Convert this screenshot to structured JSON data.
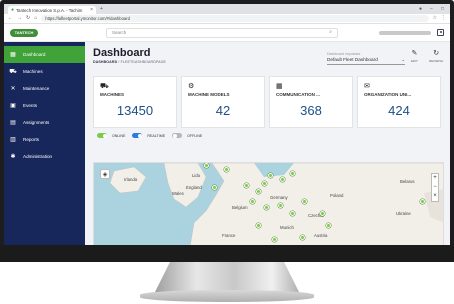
{
  "browser": {
    "tab_title": "Tantech Innovation S.p.A. - Tachim",
    "url": "https://lafleetportal.ymonitor.com/#/dashboard"
  },
  "header": {
    "logo_text": "TANTECH",
    "search_placeholder": "Search"
  },
  "sidebar": {
    "items": [
      {
        "label": "Dashboard",
        "icon": "grid-icon",
        "active": true
      },
      {
        "label": "Machines",
        "icon": "truck-icon",
        "active": false
      },
      {
        "label": "Maintenance",
        "icon": "wrench-icon",
        "active": false
      },
      {
        "label": "Events",
        "icon": "calendar-icon",
        "active": false
      },
      {
        "label": "Assignments",
        "icon": "assignment-icon",
        "active": false
      },
      {
        "label": "Reports",
        "icon": "chart-icon",
        "active": false
      },
      {
        "label": "Administration",
        "icon": "gear-icon",
        "active": false
      }
    ]
  },
  "page": {
    "title": "Dashboard",
    "breadcrumb_root": "DASHBOARD",
    "breadcrumb_tail": "/ FLEETDASHBOARDPAGE",
    "dashboard_label": "Dashboard impostata",
    "dashboard_value": "Default Fleet Dashboard",
    "edit_label": "EDIT",
    "refresh_label": "REFRESH"
  },
  "cards": [
    {
      "title": "MACHINES",
      "value": "13450",
      "icon": "truck-icon"
    },
    {
      "title": "MACHINE MODELS",
      "value": "42",
      "icon": "machine-models-icon"
    },
    {
      "title": "COMMUNICATION ...",
      "value": "368",
      "icon": "device-icon"
    },
    {
      "title": "ORGANIZATION UNI...",
      "value": "424",
      "icon": "organization-icon"
    }
  ],
  "legend": {
    "online": "ONLINE",
    "realtime": "REALTIME",
    "offline": "OFFLINE"
  },
  "map": {
    "places": [
      "Irlanda",
      "Lido",
      "Wales",
      "England",
      "Belgium",
      "Germany",
      "Czechia",
      "Poland",
      "Belarus",
      "France",
      "Austria",
      "Ukraine",
      "Munich"
    ]
  },
  "colors": {
    "sidebar": "#17265b",
    "active": "#3fa33a",
    "online": "#7ec84a",
    "realtime": "#2d7be0",
    "offline": "#b7b7b7",
    "kpi_value": "#1f4f86"
  }
}
